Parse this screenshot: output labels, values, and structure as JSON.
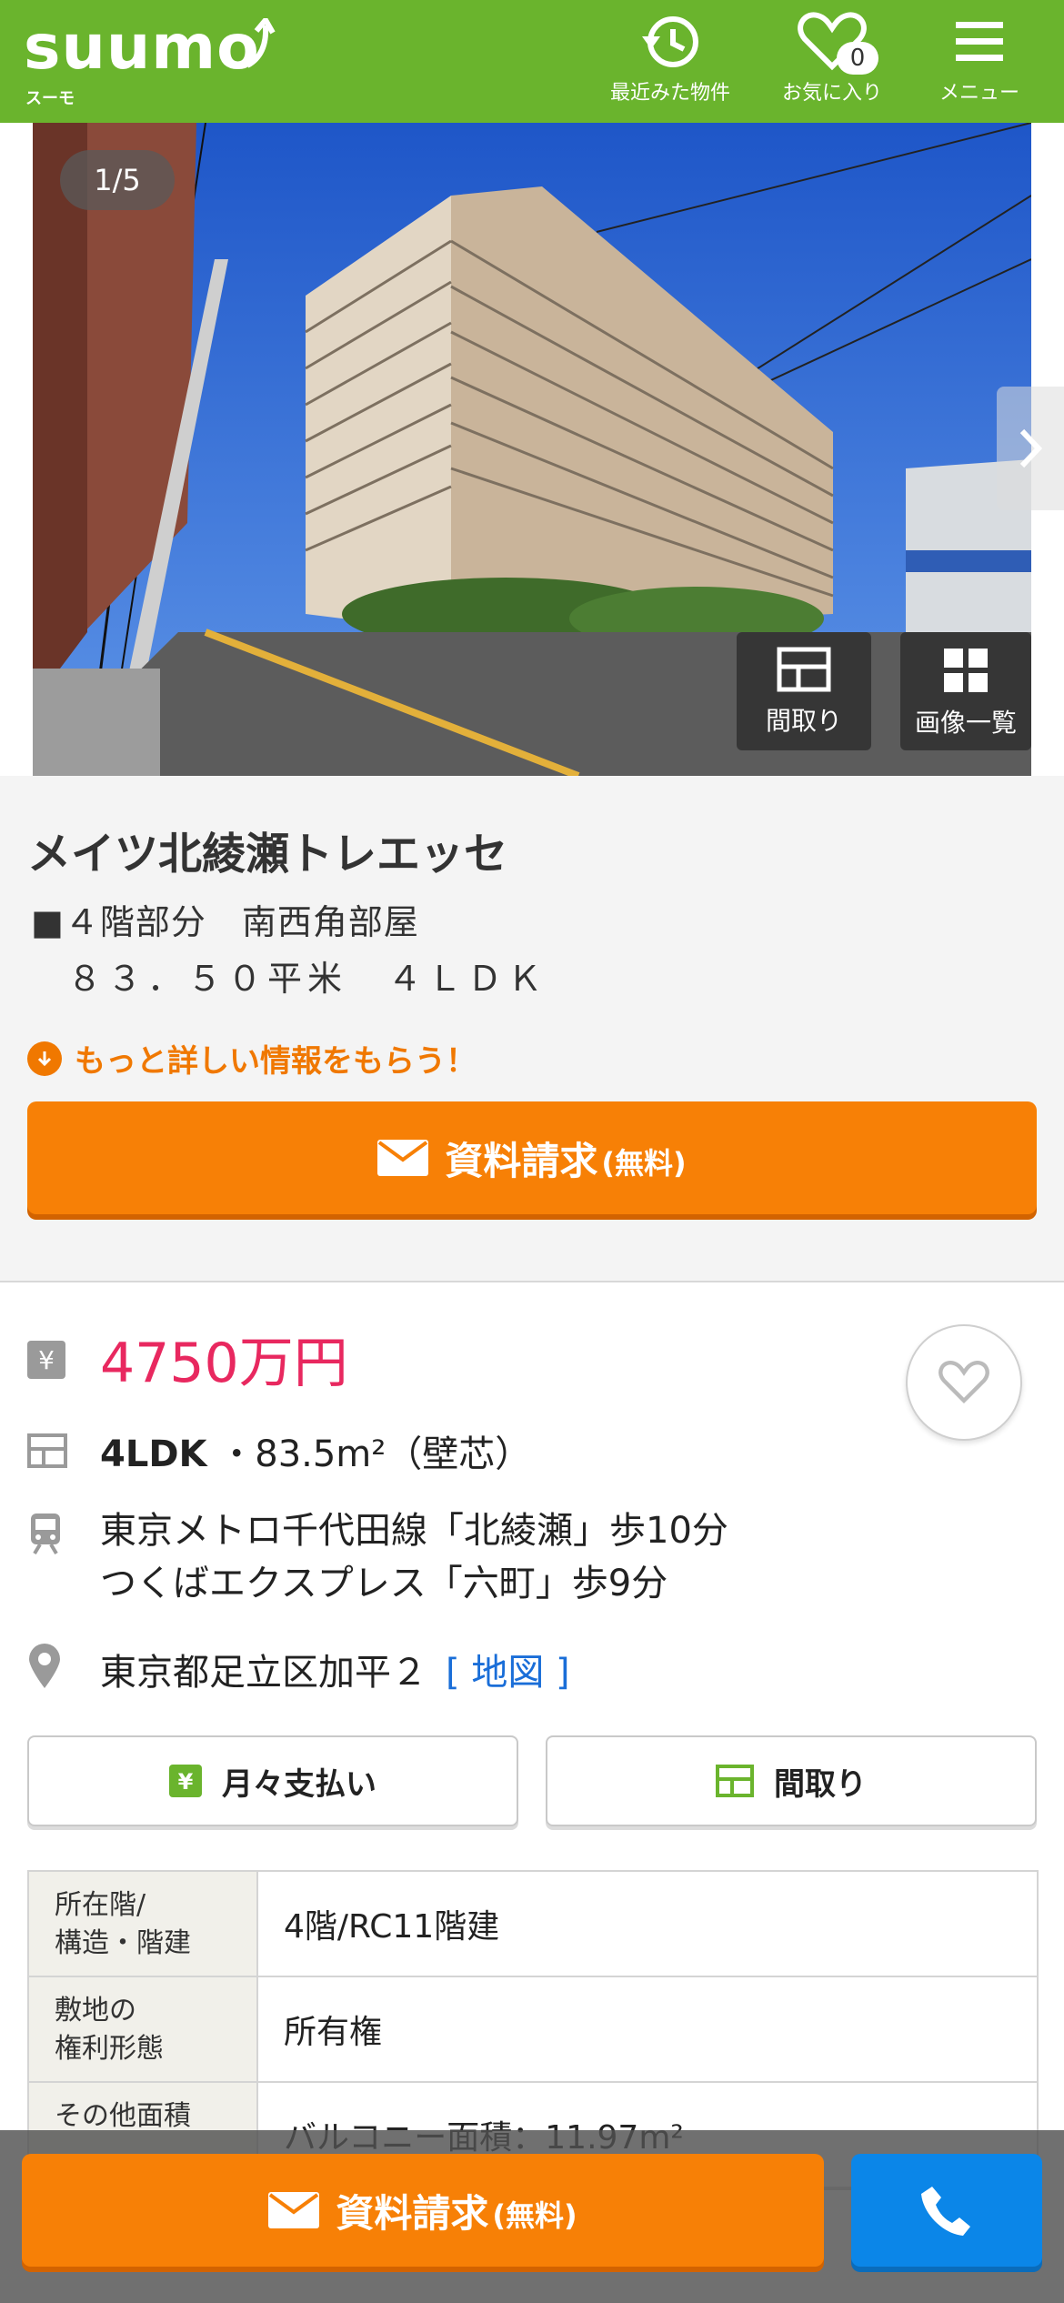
{
  "header": {
    "logo": "suumo",
    "logo_sub": "スーモ",
    "nav": [
      {
        "label": "最近みた物件",
        "icon": "history-icon"
      },
      {
        "label": "お気に入り",
        "icon": "heart-icon",
        "count": "0"
      },
      {
        "label": "メニュー",
        "icon": "hamburger-icon"
      }
    ],
    "brand_color": "#6ab42d"
  },
  "gallery": {
    "counter": "1/5",
    "floorplan_label": "間取り",
    "all_images_label": "画像一覧"
  },
  "summary": {
    "title": "メイツ北綾瀬トレエッセ",
    "line1": "■４階部分　南西角部屋",
    "line2": "８３．５０平米　４ＬＤＫ",
    "more_info": "もっと詳しい情報をもらう！",
    "cta_main": "資料請求",
    "cta_free": "(無料)"
  },
  "details": {
    "price": "4750万円",
    "layout": "4LDK",
    "area": "・83.5m²（壁芯）",
    "station_1": "東京メトロ千代田線「北綾瀬」歩10分",
    "station_2": "つくばエクスプレス「六町」歩9分",
    "address": "東京都足立区加平２",
    "map_link": "[ 地図 ]",
    "monthly_button": "月々支払い",
    "floorplan_button": "間取り"
  },
  "spec_table": [
    {
      "header_1": "所在階/",
      "header_2": "構造・階建",
      "value": "4階/RC11階建"
    },
    {
      "header_1": "敷地の",
      "header_2": "権利形態",
      "value": "所有権"
    },
    {
      "header_1": "その他面積",
      "header_2": "",
      "value": "バルコニー面積：11.97m²"
    }
  ],
  "bottom_bar": {
    "cta_main": "資料請求",
    "cta_free": "(無料)",
    "tel_icon": "phone-icon"
  },
  "colors": {
    "accent_orange": "#f78006",
    "price_pink": "#e8285f",
    "tel_blue": "#0b86e8"
  }
}
